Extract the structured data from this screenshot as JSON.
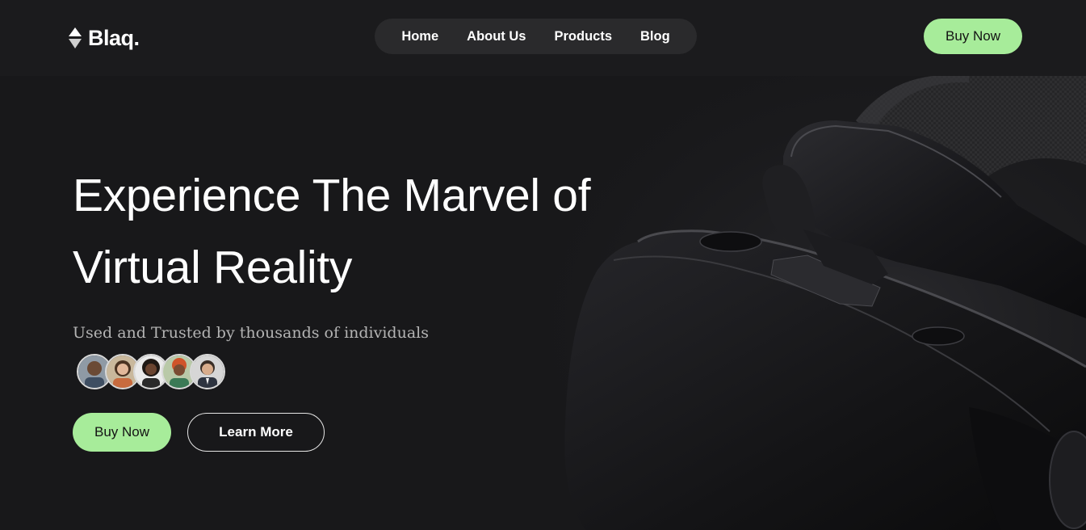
{
  "brand": {
    "name": "Blaq.",
    "icon": "diamond-arrows-icon"
  },
  "nav": {
    "items": [
      {
        "label": "Home"
      },
      {
        "label": "About Us"
      },
      {
        "label": "Products"
      },
      {
        "label": "Blog"
      }
    ]
  },
  "header": {
    "cta_label": "Buy Now"
  },
  "hero": {
    "title_line1": "Experience The Marvel of",
    "title_line2": "Virtual Reality",
    "subtitle": "Used and Trusted by thousands of individuals",
    "avatars": [
      {
        "name": "avatar-man-beard"
      },
      {
        "name": "avatar-woman-smiling"
      },
      {
        "name": "avatar-woman-curly-hair"
      },
      {
        "name": "avatar-woman-headwrap"
      },
      {
        "name": "avatar-man-suit"
      }
    ],
    "primary_cta": "Buy Now",
    "secondary_cta": "Learn More",
    "image": "vr-headset-image"
  },
  "colors": {
    "background": "#18181a",
    "accent": "#a7ec9a",
    "nav_pill": "#2a2a2c",
    "subtitle_text": "#b4b4b4"
  }
}
